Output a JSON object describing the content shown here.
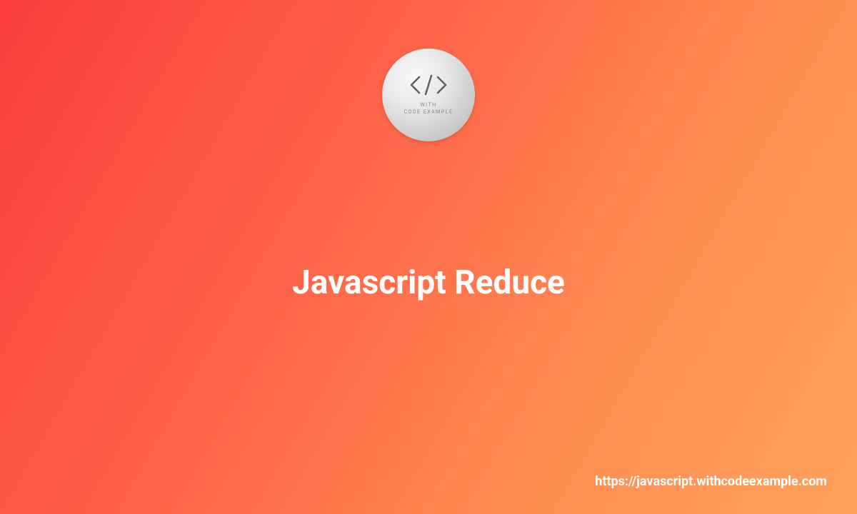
{
  "logo": {
    "line1": "WITH",
    "line2": "CODE EXAMPLE"
  },
  "title": "Javascript Reduce",
  "url": "https://javascript.withcodeexample.com"
}
